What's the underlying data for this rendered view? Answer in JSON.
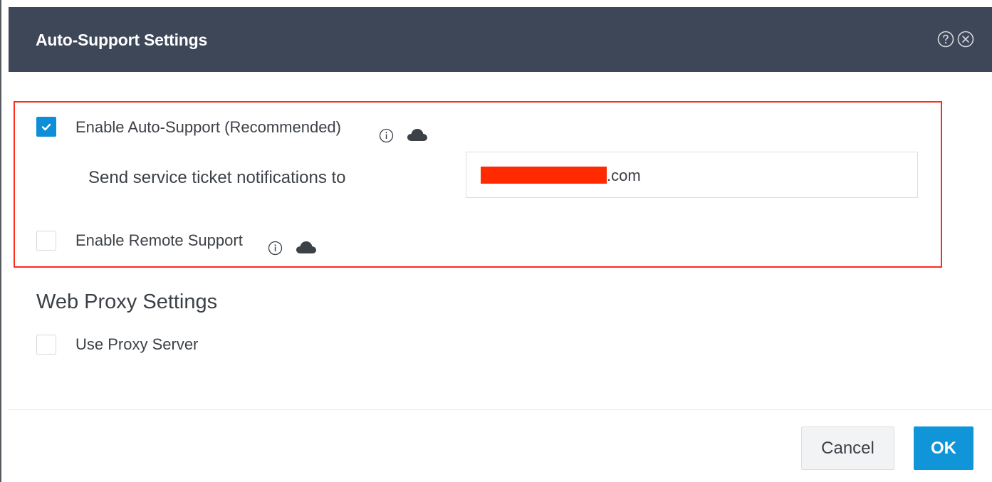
{
  "dialog": {
    "title": "Auto-Support Settings",
    "help_icon": "help-circle-icon",
    "close_icon": "close-circle-icon"
  },
  "auto_support": {
    "enable_label": "Enable Auto-Support (Recommended)",
    "enable_checked": true,
    "notify_label": "Send service ticket notifications to",
    "email_visible_suffix": ".com",
    "remote_label": "Enable Remote Support",
    "remote_checked": false
  },
  "web_proxy": {
    "title": "Web Proxy Settings",
    "use_proxy_label": "Use Proxy Server",
    "use_proxy_checked": false
  },
  "footer": {
    "cancel_label": "Cancel",
    "ok_label": "OK"
  },
  "colors": {
    "header_bg": "#3d4758",
    "checkbox_checked": "#0e8ed9",
    "ok_button": "#0f95d8",
    "highlight_border": "#ff2a1e"
  }
}
